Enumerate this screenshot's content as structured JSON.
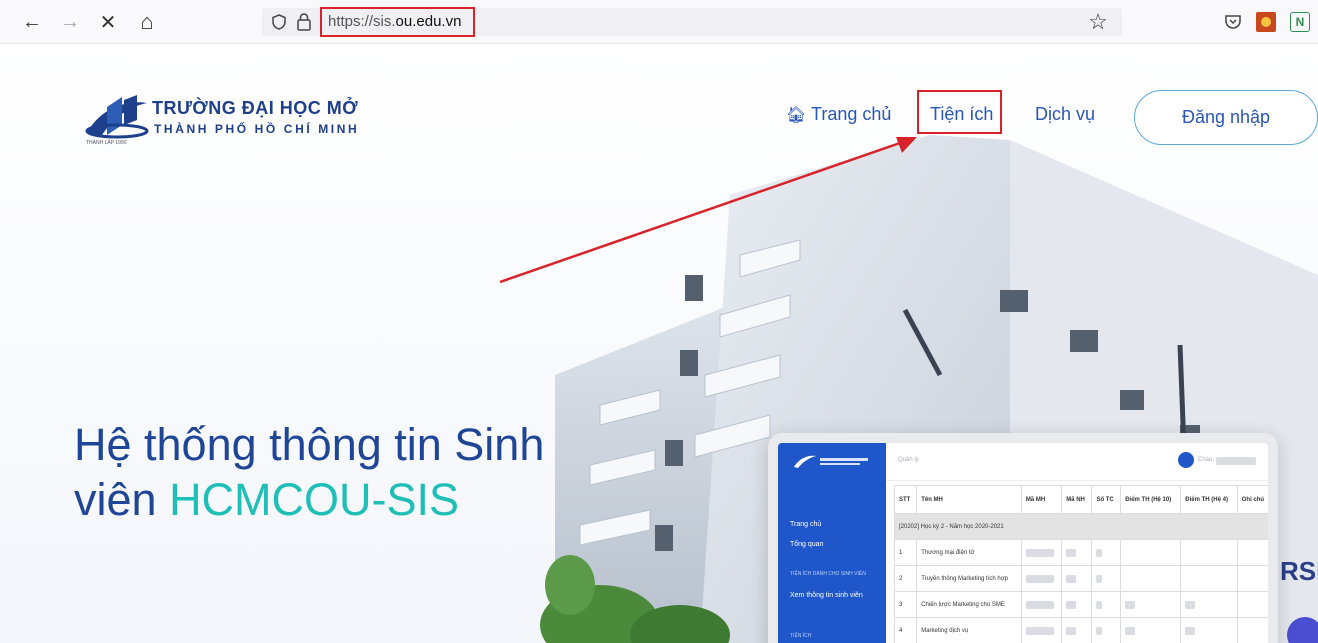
{
  "browser": {
    "url_prefix": "https://sis.",
    "url_domain": "ou.edu.vn",
    "icons": [
      "back-icon",
      "forward-icon",
      "stop-icon",
      "home-icon",
      "shield-icon",
      "lock-icon",
      "bookmark-star-icon",
      "pocket-icon",
      "extension-icon",
      "extension-n-icon"
    ],
    "back_glyph": "←",
    "forward_glyph": "→",
    "stop_glyph": "✕",
    "home_glyph": "⌂",
    "star_glyph": "☆",
    "ext_n_glyph": "N"
  },
  "site": {
    "logo_line1": "TRƯỜNG ĐẠI HỌC MỞ",
    "logo_line2": "THÀNH PHỐ HỒ CHÍ MINH",
    "logo_tiny": "THÀNH LẬP 1990",
    "nav": {
      "home": "Trang chủ",
      "tien_ich": "Tiện ích",
      "dich_vu": "Dịch vụ",
      "login": "Đăng nhập"
    },
    "hero_line1": "Hệ thống thông tin Sinh",
    "hero_line2_prefix": "viên ",
    "hero_line2_accent": "HCMCOU-SIS"
  },
  "mockup": {
    "sidebar": {
      "items": [
        "Trang chủ",
        "Tổng quan"
      ],
      "section1": "TIỆN ÍCH DÀNH CHO SINH VIÊN",
      "section1_items": [
        "Xem thông tin sinh viên"
      ],
      "section2": "TIỆN ÍCH"
    },
    "header_label": "Quản lý",
    "user_label": "Chào,",
    "table": {
      "columns": [
        "STT",
        "Tên MH",
        "Mã MH",
        "Mã NH",
        "Số TC",
        "Điểm TH (Hệ 10)",
        "Điểm TH (Hệ 4)",
        "Ghi chú"
      ],
      "group": "[20202] Học kỳ 2 - Năm học 2020-2021",
      "rows": [
        {
          "stt": "1",
          "name": "Thương mại điện tử"
        },
        {
          "stt": "2",
          "name": "Truyền thông Marketing tích hợp"
        },
        {
          "stt": "3",
          "name": "Chiến lược Marketing cho SME"
        },
        {
          "stt": "4",
          "name": "Marketing dịch vụ"
        }
      ]
    }
  },
  "colors": {
    "brand_blue": "#1d3f8c",
    "link_blue": "#2a56b8",
    "accent_teal": "#1fbfb8",
    "annotation_red": "#d9232a"
  }
}
